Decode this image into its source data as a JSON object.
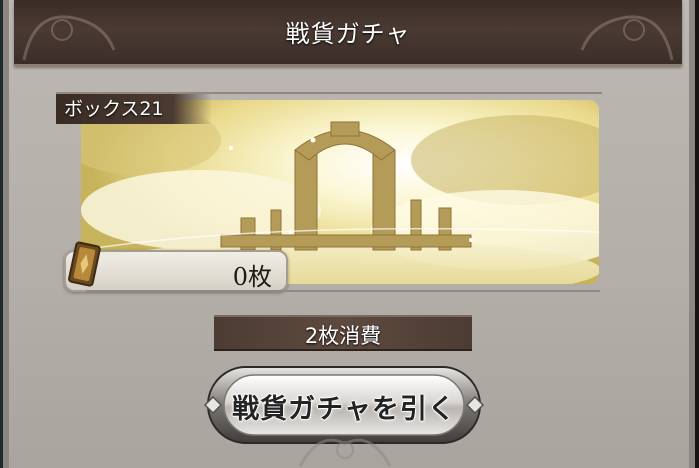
{
  "header": {
    "title": "戦貨ガチャ"
  },
  "banner": {
    "box_label": "ボックス21",
    "count": "0枚"
  },
  "cost": {
    "label": "2枚消費"
  },
  "action": {
    "button_label": "戦貨ガチャを引く"
  },
  "colors": {
    "header_bg": "#3a2c26",
    "panel_bg": "#b6b1ab",
    "label_bg": "#4a3a31",
    "banner_sky": "#f3ecb8"
  },
  "icons": {
    "ticket": "ticket-icon",
    "button_gems": "diamond-icon"
  }
}
